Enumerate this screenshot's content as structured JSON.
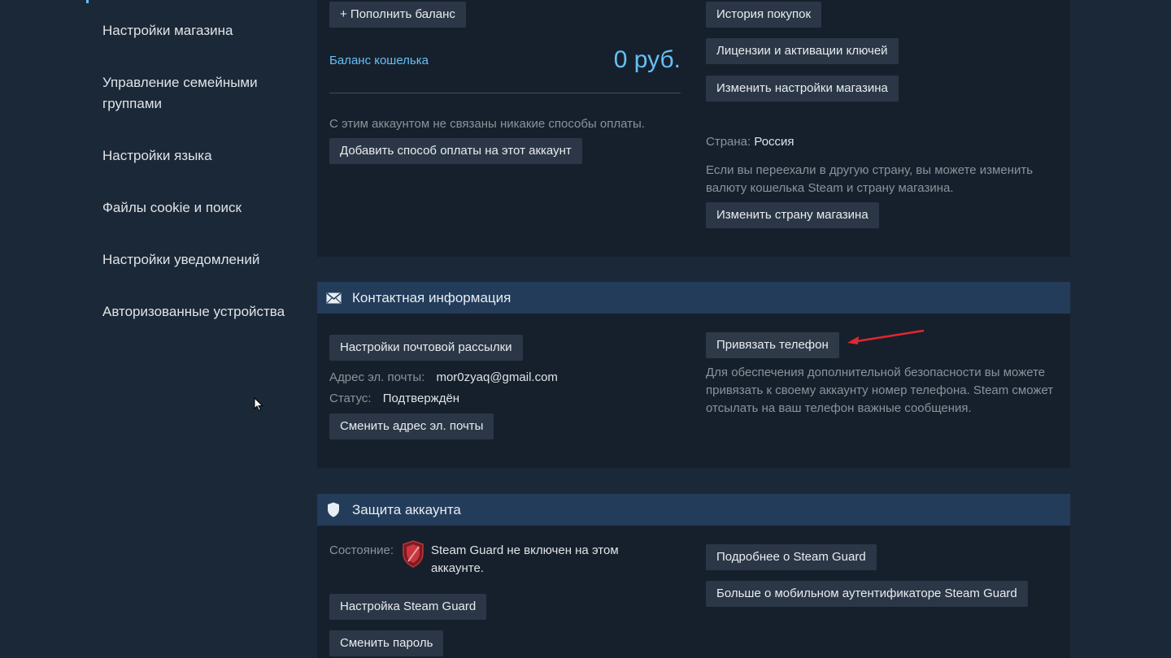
{
  "sidebar": {
    "items": [
      {
        "label": "Настройки магазина"
      },
      {
        "label": "Управление семейными группами"
      },
      {
        "label": "Настройки языка"
      },
      {
        "label": "Файлы cookie и поиск"
      },
      {
        "label": "Настройки уведомлений"
      },
      {
        "label": "Авторизованные устройства"
      }
    ]
  },
  "store": {
    "add_funds_button": "+ Пополнить баланс",
    "wallet_balance_label": "Баланс кошелька",
    "wallet_balance_value": "0 руб.",
    "no_payment_text": "С этим аккаунтом не связаны никакие способы оплаты.",
    "add_payment_button": "Добавить способ оплаты на этот аккаунт",
    "purchase_history_button": "История покупок",
    "licenses_button": "Лицензии и активации ключей",
    "change_store_settings_button": "Изменить настройки магазина",
    "country_label": "Страна:",
    "country_value": "Россия",
    "moved_text": "Если вы переехали в другую страну, вы можете изменить валюту кошелька Steam и страну магазина.",
    "change_country_button": "Изменить страну магазина"
  },
  "contact": {
    "title": "Контактная информация",
    "newsletter_button": "Настройки почтовой рассылки",
    "email_label": "Адрес эл. почты:",
    "email_value": "mor0zyaq@gmail.com",
    "status_label": "Статус:",
    "status_value": "Подтверждён",
    "change_email_button": "Сменить адрес эл. почты",
    "add_phone_button": "Привязать телефон",
    "phone_text": "Для обеспечения дополнительной безопасности вы можете привязать к своему аккаунту номер телефона. Steam сможет отсылать на ваш телефон важные сообщения."
  },
  "security": {
    "title": "Защита аккаунта",
    "state_label": "Состояние:",
    "state_value": "Steam Guard не включен на этом аккаунте.",
    "steam_guard_setup_button": "Настройка Steam Guard",
    "change_password_button": "Сменить пароль",
    "more_steam_guard_button": "Подробнее о Steam Guard",
    "mobile_auth_button": "Больше о мобильном аутентификаторе Steam Guard"
  },
  "colors": {
    "background": "#1b2838",
    "panel": "#16202d",
    "header": "#233c5a",
    "accent": "#66c0f4",
    "annotation_arrow": "#e0282e"
  },
  "icons": {
    "contact": "envelope-icon",
    "security": "shield-icon",
    "state": "red-shield-icon",
    "cursor": "mouse-cursor-icon"
  }
}
